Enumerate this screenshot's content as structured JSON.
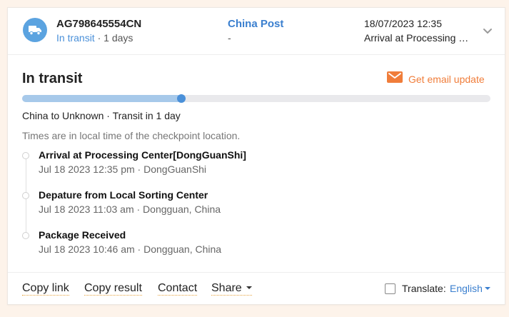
{
  "shipment": {
    "tracking_number": "AG798645554CN",
    "status": "In transit",
    "duration_suffix": " · 1 days",
    "carrier": "China Post",
    "carrier_sub": "-",
    "latest_datetime": "18/07/2023 12:35",
    "latest_event": "Arrival at Processing Center[DongGuanShi]"
  },
  "detail": {
    "title": "In transit",
    "email_update_label": "Get email update",
    "progress": 0.34,
    "route_summary": "China to Unknown · Transit in 1 day",
    "timezone_note": "Times are in local time of the checkpoint location."
  },
  "events": [
    {
      "title": "Arrival at Processing Center[DongGuanShi]",
      "meta": "Jul 18 2023 12:35 pm · DongGuanShi"
    },
    {
      "title": "Depature from Local Sorting Center",
      "meta": "Jul 18 2023 11:03 am · Dongguan, China"
    },
    {
      "title": "Package Received",
      "meta": "Jul 18 2023 10:46 am · Dongguan, China"
    }
  ],
  "footer": {
    "copy_link": "Copy link",
    "copy_result": "Copy result",
    "contact": "Contact",
    "share": "Share",
    "translate_label": "Translate:",
    "language": "English"
  },
  "colors": {
    "accent_blue": "#4a90d9",
    "carrier_blue": "#3a7fcf",
    "email_orange": "#f07d3a",
    "progress_fill": "#a7c9ea",
    "page_background": "#fdf3ea"
  },
  "icons": {
    "status": "truck-icon",
    "expand": "chevron-down-icon",
    "email": "envelope-icon"
  }
}
